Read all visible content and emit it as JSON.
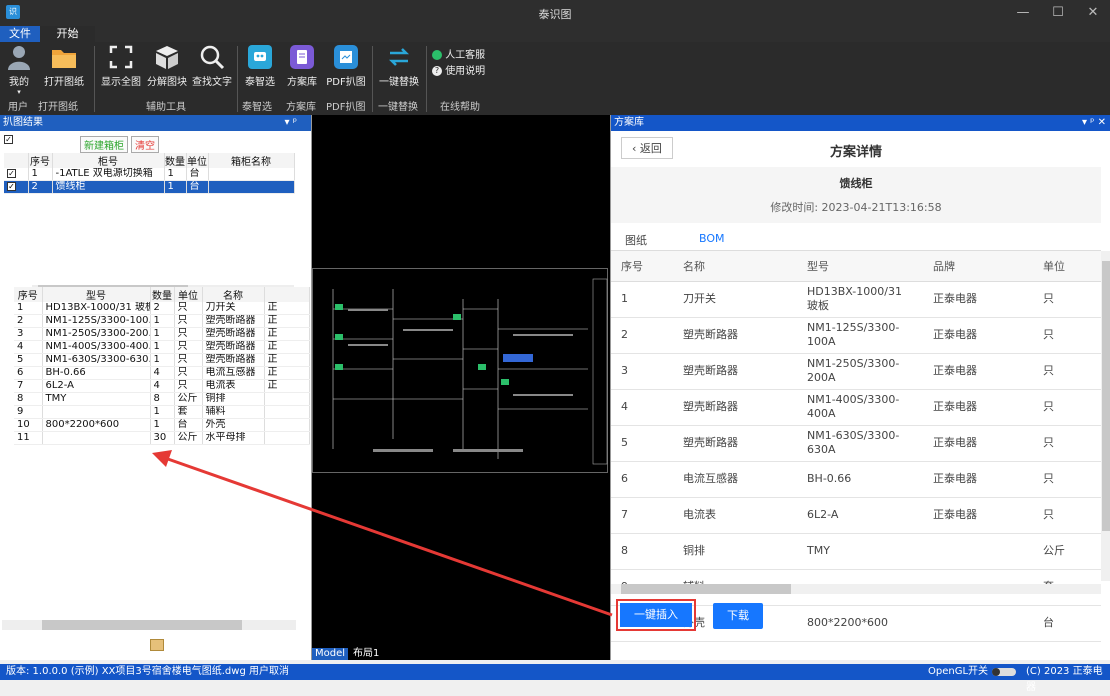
{
  "window": {
    "title": "泰识图",
    "minimize": "—",
    "maximize": "☐",
    "close": "✕"
  },
  "tabs": {
    "file": "文件",
    "start": "开始"
  },
  "ribbon": {
    "buttons": [
      {
        "key": "user",
        "label": "我的",
        "color": "#9aa7b5"
      },
      {
        "key": "open",
        "label": "打开图纸",
        "color": "#f0a43a"
      },
      {
        "key": "showall",
        "label": "显示全图",
        "color": "#e0e0e0"
      },
      {
        "key": "explode",
        "label": "分解图块",
        "color": "#e0e0e0"
      },
      {
        "key": "find",
        "label": "查找文字",
        "color": "#e0e0e0"
      },
      {
        "key": "taizhi",
        "label": "泰智选",
        "color": "#2aa7d9"
      },
      {
        "key": "scheme",
        "label": "方案库",
        "color": "#7b5ad6"
      },
      {
        "key": "pdf",
        "label": "PDF扒图",
        "color": "#2a8fd9"
      },
      {
        "key": "replace",
        "label": "一键替换",
        "color": "#2a8fd9"
      }
    ],
    "help": {
      "service": "人工客服",
      "manual": "使用说明"
    },
    "groups": [
      "用户",
      "打开图纸",
      "辅助工具",
      "泰智选",
      "方案库",
      "PDF扒图",
      "一键替换",
      "在线帮助"
    ]
  },
  "left": {
    "header": "扒图结果",
    "pin": "▾ ᵖ",
    "new_cabinet": "新建箱柜",
    "clear": "清空",
    "cab_cols": [
      "序号",
      "柜号",
      "数量",
      "单位",
      "箱柜名称"
    ],
    "cabinets": [
      {
        "no": "1",
        "code": "-1ATLE 双电源切换箱",
        "qty": "1",
        "unit": "台",
        "name": ""
      },
      {
        "no": "2",
        "code": "馈线柜",
        "qty": "1",
        "unit": "台",
        "name": ""
      }
    ],
    "item_cols": [
      "序号",
      "型号",
      "数量",
      "单位",
      "名称"
    ],
    "items": [
      {
        "no": "1",
        "model": "HD13BX-1000/31 玻板",
        "qty": "2",
        "unit": "只",
        "name": "刀开关",
        "x": "正"
      },
      {
        "no": "2",
        "model": "NM1-125S/3300-100.",
        "qty": "1",
        "unit": "只",
        "name": "塑壳断路器",
        "x": "正"
      },
      {
        "no": "3",
        "model": "NM1-250S/3300-200.",
        "qty": "1",
        "unit": "只",
        "name": "塑壳断路器",
        "x": "正"
      },
      {
        "no": "4",
        "model": "NM1-400S/3300-400.",
        "qty": "1",
        "unit": "只",
        "name": "塑壳断路器",
        "x": "正"
      },
      {
        "no": "5",
        "model": "NM1-630S/3300-630.",
        "qty": "1",
        "unit": "只",
        "name": "塑壳断路器",
        "x": "正"
      },
      {
        "no": "6",
        "model": "BH-0.66",
        "qty": "4",
        "unit": "只",
        "name": "电流互感器",
        "x": "正"
      },
      {
        "no": "7",
        "model": "6L2-A",
        "qty": "4",
        "unit": "只",
        "name": "电流表",
        "x": "正"
      },
      {
        "no": "8",
        "model": "TMY",
        "qty": "8",
        "unit": "公斤",
        "name": "铜排",
        "x": ""
      },
      {
        "no": "9",
        "model": "",
        "qty": "1",
        "unit": "套",
        "name": "辅料",
        "x": ""
      },
      {
        "no": "10",
        "model": "800*2200*600",
        "qty": "1",
        "unit": "台",
        "name": "外壳",
        "x": ""
      },
      {
        "no": "11",
        "model": "",
        "qty": "30",
        "unit": "公斤",
        "name": "水平母排",
        "x": ""
      }
    ]
  },
  "cad": {
    "model_tab": "Model",
    "layout_tab": "布局1"
  },
  "right": {
    "header": "方案库",
    "back": "返回",
    "title": "方案详情",
    "cabinet": "馈线柜",
    "modified": "修改时间: 2023-04-21T13:16:58",
    "tab_drawing": "图纸",
    "tab_bom": "BOM",
    "cols": [
      "序号",
      "名称",
      "型号",
      "品牌",
      "单位"
    ],
    "rows": [
      {
        "no": "1",
        "name": "刀开关",
        "model": "HD13BX-1000/31 玻板",
        "brand": "正泰电器",
        "unit": "只"
      },
      {
        "no": "2",
        "name": "塑壳断路器",
        "model": "NM1-125S/3300-100A",
        "brand": "正泰电器",
        "unit": "只"
      },
      {
        "no": "3",
        "name": "塑壳断路器",
        "model": "NM1-250S/3300-200A",
        "brand": "正泰电器",
        "unit": "只"
      },
      {
        "no": "4",
        "name": "塑壳断路器",
        "model": "NM1-400S/3300-400A",
        "brand": "正泰电器",
        "unit": "只"
      },
      {
        "no": "5",
        "name": "塑壳断路器",
        "model": "NM1-630S/3300-630A",
        "brand": "正泰电器",
        "unit": "只"
      },
      {
        "no": "6",
        "name": "电流互感器",
        "model": "BH-0.66",
        "brand": "正泰电器",
        "unit": "只"
      },
      {
        "no": "7",
        "name": "电流表",
        "model": "6L2-A",
        "brand": "正泰电器",
        "unit": "只"
      },
      {
        "no": "8",
        "name": "铜排",
        "model": "TMY",
        "brand": "",
        "unit": "公斤"
      },
      {
        "no": "9",
        "name": "辅料",
        "model": "",
        "brand": "",
        "unit": "套"
      },
      {
        "no": "10",
        "name": "外壳",
        "model": "800*2200*600",
        "brand": "",
        "unit": "台"
      }
    ],
    "insert": "一键插入",
    "download": "下载"
  },
  "status": {
    "left": "版本: 1.0.0.0 (示例) XX项目3号宿舍楼电气图纸.dwg 用户取消",
    "opengl": "OpenGL开关",
    "copyright": "(C) 2023 正泰电器"
  },
  "colors": {
    "accent": "#1677ff",
    "panel": "#1f5fbf",
    "annotation": "#e53935",
    "status": "#1456c8"
  }
}
